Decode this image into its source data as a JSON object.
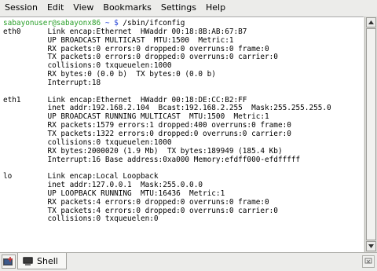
{
  "menubar": {
    "items": [
      "Session",
      "Edit",
      "View",
      "Bookmarks",
      "Settings",
      "Help"
    ]
  },
  "terminal": {
    "prompt_user": "sabayonuser@sabayonx86",
    "prompt_path": " ~ $",
    "prompt_command": " /sbin/ifconfig",
    "lines": [
      "eth0      Link encap:Ethernet  HWaddr 00:18:8B:AB:67:B7",
      "          UP BROADCAST MULTICAST  MTU:1500  Metric:1",
      "          RX packets:0 errors:0 dropped:0 overruns:0 frame:0",
      "          TX packets:0 errors:0 dropped:0 overruns:0 carrier:0",
      "          collisions:0 txqueuelen:1000",
      "          RX bytes:0 (0.0 b)  TX bytes:0 (0.0 b)",
      "          Interrupt:18",
      "",
      "eth1      Link encap:Ethernet  HWaddr 00:18:DE:CC:B2:FF",
      "          inet addr:192.168.2.104  Bcast:192.168.2.255  Mask:255.255.255.0",
      "          UP BROADCAST RUNNING MULTICAST  MTU:1500  Metric:1",
      "          RX packets:1579 errors:1 dropped:400 overruns:0 frame:0",
      "          TX packets:1322 errors:0 dropped:0 overruns:0 carrier:0",
      "          collisions:0 txqueuelen:1000",
      "          RX bytes:2000020 (1.9 Mb)  TX bytes:189949 (185.4 Kb)",
      "          Interrupt:16 Base address:0xa000 Memory:efdff000-efdfffff",
      "",
      "lo        Link encap:Local Loopback",
      "          inet addr:127.0.0.1  Mask:255.0.0.0",
      "          UP LOOPBACK RUNNING  MTU:16436  Metric:1",
      "          RX packets:4 errors:0 dropped:0 overruns:0 frame:0",
      "          TX packets:4 errors:0 dropped:0 overruns:0 carrier:0",
      "          collisions:0 txqueuelen:0"
    ]
  },
  "tabs": [
    {
      "label": "Shell",
      "icon": "terminal-icon"
    }
  ],
  "colors": {
    "prompt_user": "#2aa02a",
    "prompt_path": "#1f3fd6"
  }
}
